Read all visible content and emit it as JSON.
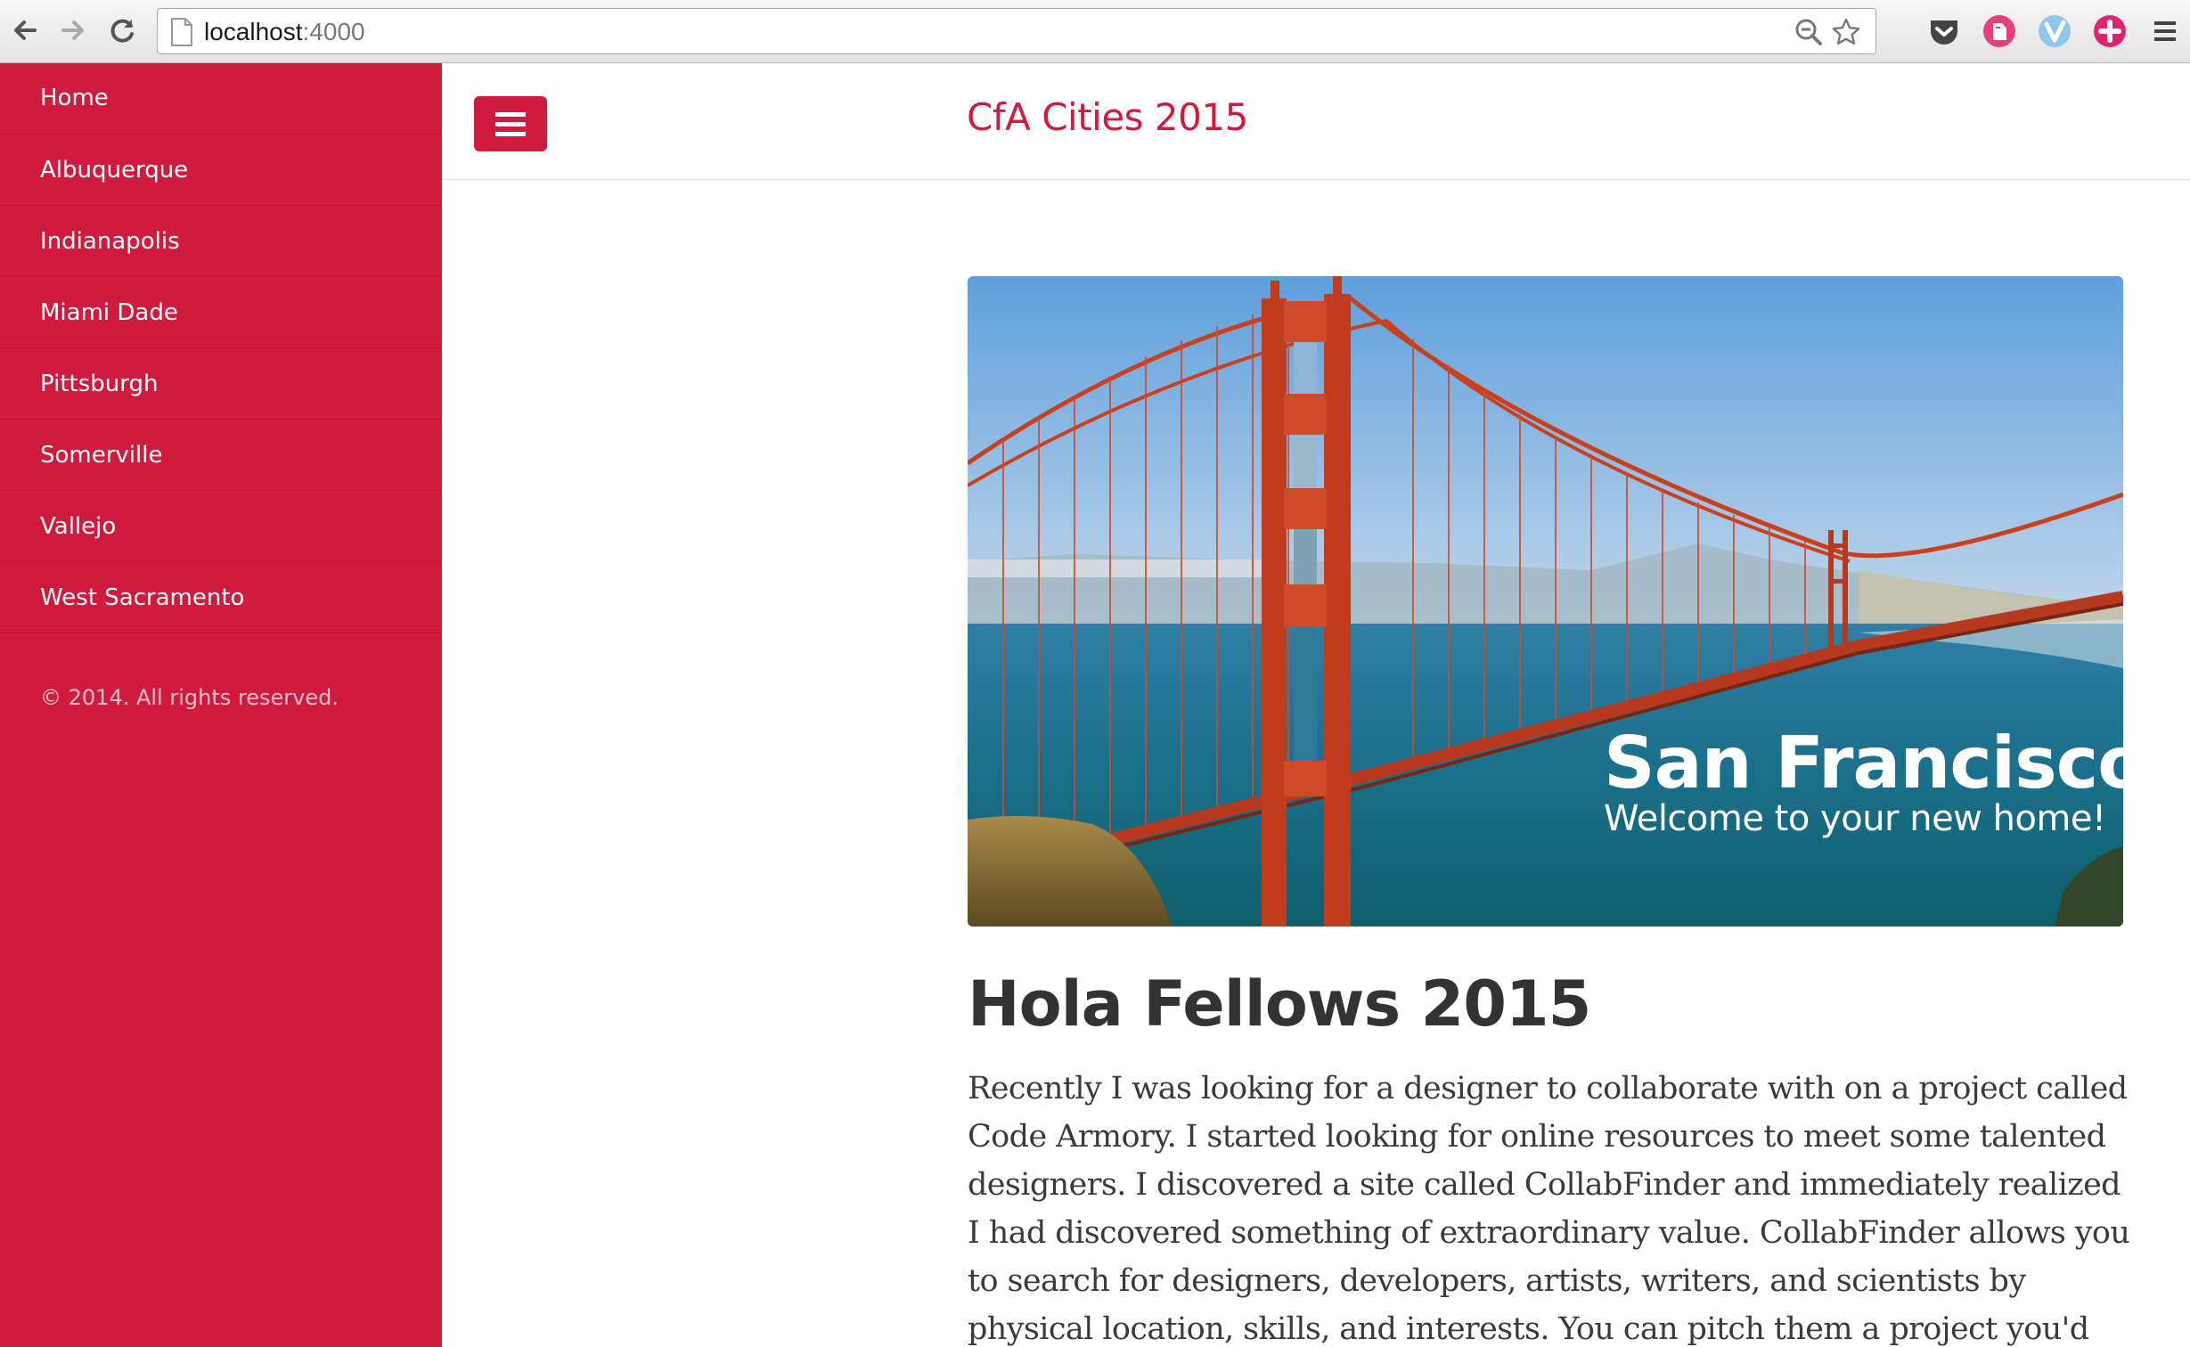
{
  "browser": {
    "url_host": "localhost",
    "url_port": ":4000",
    "icons": [
      "back-arrow-icon",
      "forward-arrow-icon",
      "reload-icon",
      "page-icon",
      "zoom-icon",
      "bookmark-star-icon",
      "pocket-icon",
      "evernote-icon",
      "extension-v-icon",
      "plus-extension-icon",
      "menu-icon"
    ]
  },
  "sidebar": {
    "items": [
      {
        "label": "Home"
      },
      {
        "label": "Albuquerque"
      },
      {
        "label": "Indianapolis"
      },
      {
        "label": "Miami Dade"
      },
      {
        "label": "Pittsburgh"
      },
      {
        "label": "Somerville"
      },
      {
        "label": "Vallejo"
      },
      {
        "label": "West Sacramento"
      }
    ],
    "copyright": "© 2014. All rights reserved."
  },
  "header": {
    "title": "CfA Cities 2015",
    "menu_icon": "hamburger-icon"
  },
  "hero": {
    "title": "San Francisco",
    "subtitle": "Welcome to your new home!"
  },
  "post": {
    "title": "Hola Fellows 2015",
    "body": "Recently I was looking for a designer to collaborate with on a project called Code Armory. I started looking for online resources to meet some talented designers. I discovered a site called CollabFinder and immediately realized I had discovered something of extraordinary value. CollabFinder allows you to search for designers, developers, artists, writers, and scientists by physical location, skills, and interests. You can pitch them a project you'd like to \"collaborate\" on"
  },
  "colors": {
    "accent": "#d11b3e",
    "text": "#333333"
  }
}
